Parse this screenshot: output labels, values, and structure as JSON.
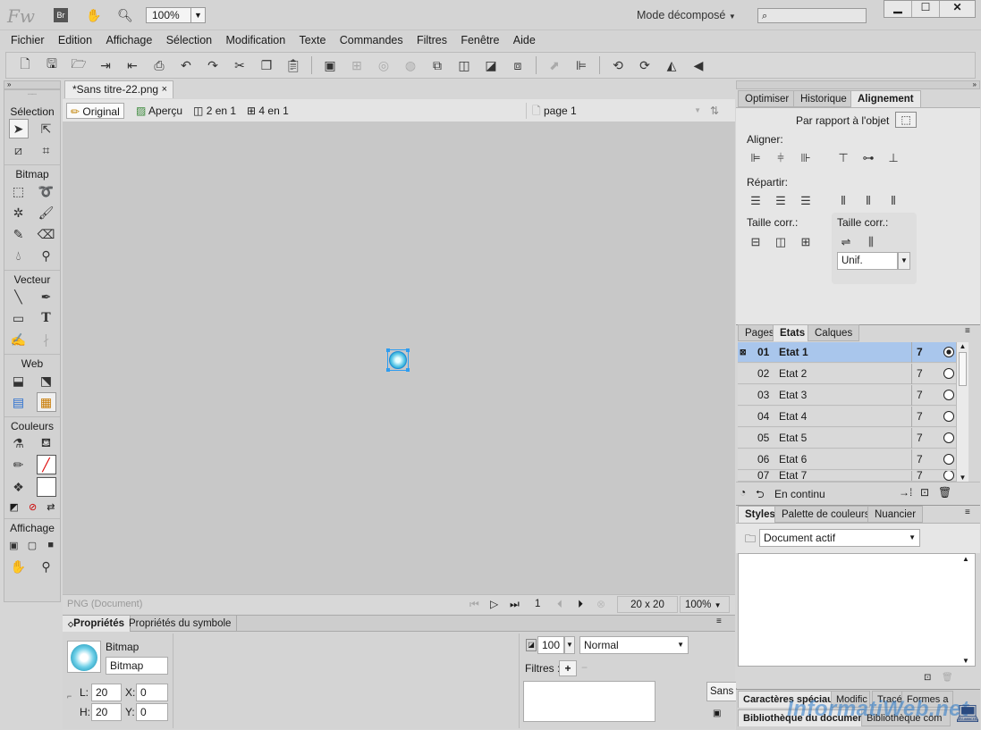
{
  "app": {
    "logo": "Fw",
    "bridge": "Br",
    "zoom": "100%",
    "workspace": "Mode décomposé",
    "search_placeholder": ""
  },
  "menu": [
    "Fichier",
    "Edition",
    "Affichage",
    "Sélection",
    "Modification",
    "Texte",
    "Commandes",
    "Filtres",
    "Fenêtre",
    "Aide"
  ],
  "tools": {
    "selection": "Sélection",
    "bitmap": "Bitmap",
    "vector": "Vecteur",
    "web": "Web",
    "colors": "Couleurs",
    "display": "Affichage"
  },
  "document": {
    "tab_title": "*Sans titre-22.png",
    "view_original": "Original",
    "view_preview": "Aperçu",
    "view_2up": "2 en 1",
    "view_4up": "4 en 1",
    "page": "page 1",
    "status_type": "PNG (Document)",
    "frame": "1",
    "size": "20 x 20",
    "zoom": "100%"
  },
  "properties": {
    "tab_props": "Propriétés",
    "tab_symbol": "Propriétés du symbole",
    "type": "Bitmap",
    "name": "Bitmap",
    "w_label": "L:",
    "w": "20",
    "h_label": "H:",
    "h": "20",
    "x_label": "X:",
    "x": "0",
    "y_label": "Y:",
    "y": "0",
    "opacity": "100",
    "blend": "Normal",
    "filters_label": "Filtres :",
    "font_btn": "Sans"
  },
  "align_panel": {
    "tabs": [
      "Optimiser",
      "Historique",
      "Alignement"
    ],
    "relative": "Par rapport à l'objet",
    "align": "Aligner:",
    "distribute": "Répartir:",
    "match1": "Taille corr.:",
    "match2": "Taille corr.:",
    "uniform": "Unif."
  },
  "states_panel": {
    "tabs": [
      "Pages",
      "Etats",
      "Calques"
    ],
    "rows": [
      {
        "num": "01",
        "name": "Etat 1",
        "delay": "7"
      },
      {
        "num": "02",
        "name": "Etat 2",
        "delay": "7"
      },
      {
        "num": "03",
        "name": "Etat 3",
        "delay": "7"
      },
      {
        "num": "04",
        "name": "Etat 4",
        "delay": "7"
      },
      {
        "num": "05",
        "name": "Etat 5",
        "delay": "7"
      },
      {
        "num": "06",
        "name": "Etat 6",
        "delay": "7"
      },
      {
        "num": "07",
        "name": "Etat 7",
        "delay": "7"
      }
    ],
    "loop": "En continu"
  },
  "styles_panel": {
    "tabs": [
      "Styles",
      "Palette de couleurs",
      "Nuancier"
    ],
    "dropdown": "Document actif"
  },
  "bottom_tabs": {
    "row1": [
      "Caractères spéciaux",
      "Modific",
      "Tracé",
      "Formes a"
    ],
    "row2": [
      "Bibliothèque du document",
      "Bibliothèque com"
    ]
  },
  "watermark": "InformatiWeb.net",
  "colors": {
    "selection": "#a9c6ec",
    "accent": "#29a3e8"
  }
}
